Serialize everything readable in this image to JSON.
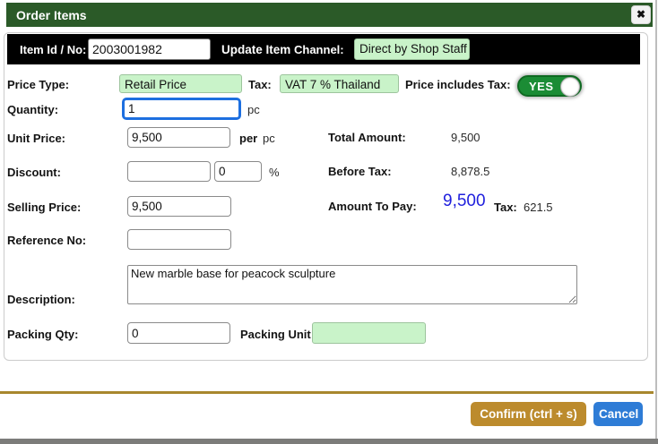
{
  "modal": {
    "title": "Order Items",
    "close_icon": "✖"
  },
  "item_bar": {
    "item_id_label": "Item Id / No:",
    "item_id_value": "2003001982",
    "update_item_label": "Update Item",
    "channel_label": "Channel:",
    "channel_value": "Direct by Shop Staff"
  },
  "form": {
    "price_type_label": "Price Type:",
    "price_type_value": "Retail Price",
    "tax_label": "Tax:",
    "tax_value": "VAT 7 % Thailand",
    "price_includes_tax_label": "Price includes Tax:",
    "price_includes_tax_value": "YES",
    "quantity_label": "Quantity:",
    "quantity_value": "1",
    "quantity_unit": "pc",
    "unit_price_label": "Unit Price:",
    "unit_price_value": "9,500",
    "per_label": "per",
    "per_unit": "pc",
    "discount_label": "Discount:",
    "discount_amount_value": "",
    "discount_percent_value": "0",
    "percent_sign": "%",
    "selling_price_label": "Selling Price:",
    "selling_price_value": "9,500",
    "reference_no_label": "Reference No:",
    "reference_no_value": "",
    "description_label": "Description:",
    "description_value": "New marble base for peacock sculpture",
    "packing_qty_label": "Packing Qty:",
    "packing_qty_value": "0",
    "packing_unit_label": "Packing Unit:",
    "packing_unit_value": ""
  },
  "summary": {
    "total_amount_label": "Total Amount:",
    "total_amount_value": "9,500",
    "before_tax_label": "Before Tax:",
    "before_tax_value": "8,878.5",
    "amount_to_pay_label": "Amount To Pay:",
    "amount_to_pay_value": "9,500",
    "tax_label": "Tax:",
    "tax_value": "621.5"
  },
  "footer": {
    "confirm_label": "Confirm (ctrl + s)",
    "cancel_label": "Cancel"
  },
  "colors": {
    "header_green": "#2b5a28",
    "field_green": "#c9f3c9",
    "toggle_green": "#1b8c35",
    "accent_blue": "#2020dd",
    "focus_blue": "#1d6fe0",
    "divider_gold": "#a8872e",
    "confirm_gold": "#bc8b2d",
    "cancel_blue": "#2e7cd6"
  }
}
